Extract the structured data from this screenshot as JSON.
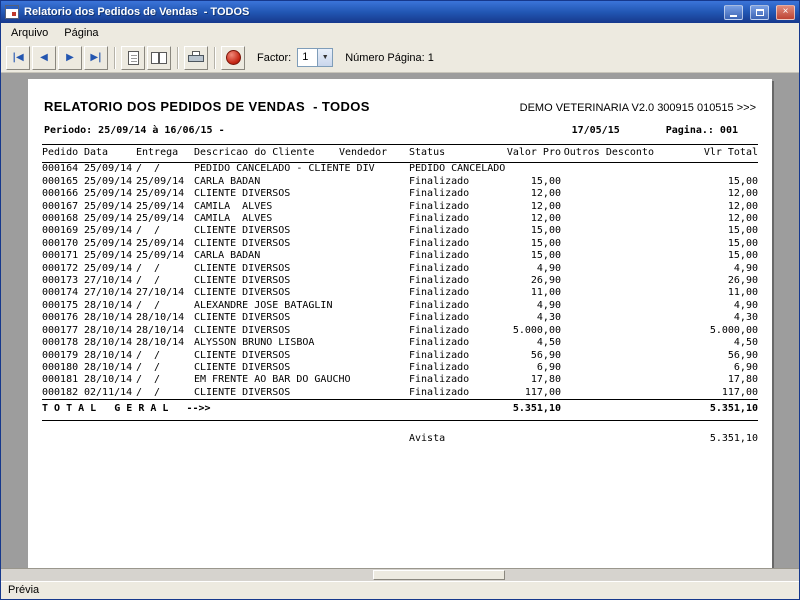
{
  "window": {
    "title": "Relatorio dos Pedidos de Vendas  - TODOS",
    "controls": {
      "close": "×"
    },
    "status_text": "Prévia"
  },
  "menu": {
    "items": [
      "Arquivo",
      "Página"
    ]
  },
  "toolbar": {
    "nav": {
      "first": "|◀",
      "prev": "◀",
      "next": "▶",
      "last": "▶|"
    },
    "factor_label": "Factor:",
    "factor_value": "1",
    "dropdown_glyph": "▼",
    "page_number_label": "Número Página: 1"
  },
  "report": {
    "title": "RELATORIO DOS PEDIDOS DE VENDAS  - TODOS",
    "company": "DEMO VETERINARIA V2.0 300915 010515 >>>",
    "period": "Periodo: 25/09/14 à 16/06/15 -",
    "print_date": "17/05/15",
    "page_label": "Pagina.: 001",
    "columns": [
      "Pedido",
      "Data",
      "Entrega",
      "Descricao do Cliente",
      "Vendedor",
      "Status",
      "Valor Pro",
      "Outros Desconto",
      "Vlr Total"
    ],
    "rows": [
      {
        "pedido": "000164",
        "data": "25/09/14",
        "entrega": "/  /",
        "cliente": "PEDIDO CANCELADO - CLIENTE DIV",
        "vendedor": "",
        "status": "PEDIDO CANCELADO",
        "valor": "",
        "outros": "",
        "total": ""
      },
      {
        "pedido": "000165",
        "data": "25/09/14",
        "entrega": "25/09/14",
        "cliente": "CARLA BADAN",
        "vendedor": "",
        "status": "Finalizado",
        "valor": "15,00",
        "outros": "",
        "total": "15,00"
      },
      {
        "pedido": "000166",
        "data": "25/09/14",
        "entrega": "25/09/14",
        "cliente": "CLIENTE DIVERSOS",
        "vendedor": "",
        "status": "Finalizado",
        "valor": "12,00",
        "outros": "",
        "total": "12,00"
      },
      {
        "pedido": "000167",
        "data": "25/09/14",
        "entrega": "25/09/14",
        "cliente": "CAMILA  ALVES",
        "vendedor": "",
        "status": "Finalizado",
        "valor": "12,00",
        "outros": "",
        "total": "12,00"
      },
      {
        "pedido": "000168",
        "data": "25/09/14",
        "entrega": "25/09/14",
        "cliente": "CAMILA  ALVES",
        "vendedor": "",
        "status": "Finalizado",
        "valor": "12,00",
        "outros": "",
        "total": "12,00"
      },
      {
        "pedido": "000169",
        "data": "25/09/14",
        "entrega": "/  /",
        "cliente": "CLIENTE DIVERSOS",
        "vendedor": "",
        "status": "Finalizado",
        "valor": "15,00",
        "outros": "",
        "total": "15,00"
      },
      {
        "pedido": "000170",
        "data": "25/09/14",
        "entrega": "25/09/14",
        "cliente": "CLIENTE DIVERSOS",
        "vendedor": "",
        "status": "Finalizado",
        "valor": "15,00",
        "outros": "",
        "total": "15,00"
      },
      {
        "pedido": "000171",
        "data": "25/09/14",
        "entrega": "25/09/14",
        "cliente": "CARLA BADAN",
        "vendedor": "",
        "status": "Finalizado",
        "valor": "15,00",
        "outros": "",
        "total": "15,00"
      },
      {
        "pedido": "000172",
        "data": "25/09/14",
        "entrega": "/  /",
        "cliente": "CLIENTE DIVERSOS",
        "vendedor": "",
        "status": "Finalizado",
        "valor": "4,90",
        "outros": "",
        "total": "4,90"
      },
      {
        "pedido": "000173",
        "data": "27/10/14",
        "entrega": "/  /",
        "cliente": "CLIENTE DIVERSOS",
        "vendedor": "",
        "status": "Finalizado",
        "valor": "26,90",
        "outros": "",
        "total": "26,90"
      },
      {
        "pedido": "000174",
        "data": "27/10/14",
        "entrega": "27/10/14",
        "cliente": "CLIENTE DIVERSOS",
        "vendedor": "",
        "status": "Finalizado",
        "valor": "11,00",
        "outros": "",
        "total": "11,00"
      },
      {
        "pedido": "000175",
        "data": "28/10/14",
        "entrega": "/  /",
        "cliente": "ALEXANDRE JOSE BATAGLIN",
        "vendedor": "",
        "status": "Finalizado",
        "valor": "4,90",
        "outros": "",
        "total": "4,90"
      },
      {
        "pedido": "000176",
        "data": "28/10/14",
        "entrega": "28/10/14",
        "cliente": "CLIENTE DIVERSOS",
        "vendedor": "",
        "status": "Finalizado",
        "valor": "4,30",
        "outros": "",
        "total": "4,30"
      },
      {
        "pedido": "000177",
        "data": "28/10/14",
        "entrega": "28/10/14",
        "cliente": "CLIENTE DIVERSOS",
        "vendedor": "",
        "status": "Finalizado",
        "valor": "5.000,00",
        "outros": "",
        "total": "5.000,00"
      },
      {
        "pedido": "000178",
        "data": "28/10/14",
        "entrega": "28/10/14",
        "cliente": "ALYSSON BRUNO LISBOA",
        "vendedor": "",
        "status": "Finalizado",
        "valor": "4,50",
        "outros": "",
        "total": "4,50"
      },
      {
        "pedido": "000179",
        "data": "28/10/14",
        "entrega": "/  /",
        "cliente": "CLIENTE DIVERSOS",
        "vendedor": "",
        "status": "Finalizado",
        "valor": "56,90",
        "outros": "",
        "total": "56,90"
      },
      {
        "pedido": "000180",
        "data": "28/10/14",
        "entrega": "/  /",
        "cliente": "CLIENTE DIVERSOS",
        "vendedor": "",
        "status": "Finalizado",
        "valor": "6,90",
        "outros": "",
        "total": "6,90"
      },
      {
        "pedido": "000181",
        "data": "28/10/14",
        "entrega": "/  /",
        "cliente": "EM FRENTE AO BAR DO GAUCHO",
        "vendedor": "",
        "status": "Finalizado",
        "valor": "17,80",
        "outros": "",
        "total": "17,80"
      },
      {
        "pedido": "000182",
        "data": "02/11/14",
        "entrega": "/  /",
        "cliente": "CLIENTE DIVERSOS",
        "vendedor": "",
        "status": "Finalizado",
        "valor": "117,00",
        "outros": "",
        "total": "117,00"
      }
    ],
    "total_label": "T O T A L   G E R A L   -->>",
    "total_valor": "5.351,10",
    "total_vlr": "5.351,10",
    "payment_label": "Avista",
    "payment_total": "5.351,10"
  }
}
